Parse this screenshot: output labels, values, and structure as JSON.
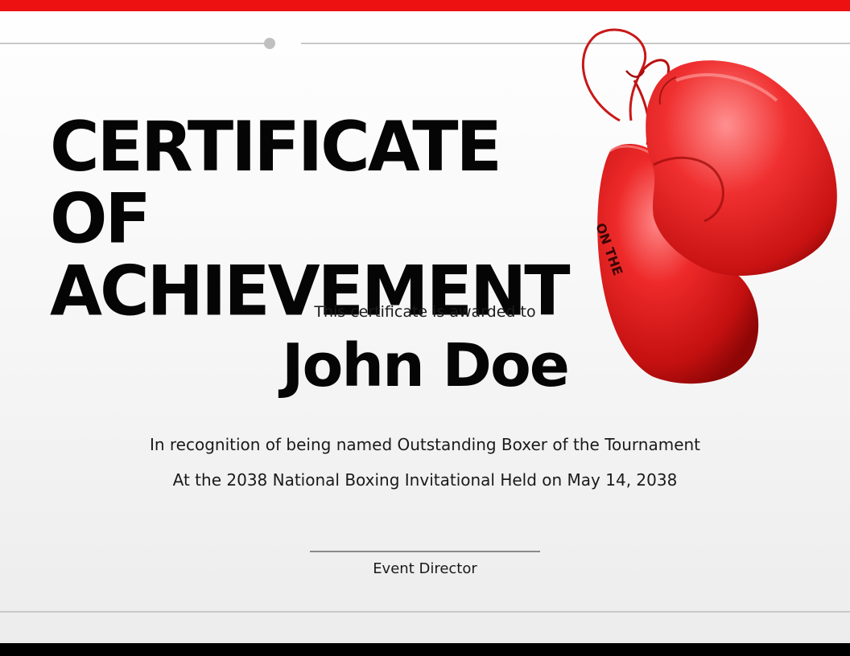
{
  "certificate": {
    "title_line1": "CERTIFICATE OF",
    "title_line2": "ACHIEVEMENT",
    "awarded_text": "This certificate is awarded to",
    "recipient_name": "John Doe",
    "recognition_line1": "In recognition of being named Outstanding Boxer of the Tournament",
    "recognition_line2": "At the 2038 National Boxing Invitational Held on May 14, 2038",
    "signature_label": "Event Director",
    "glove_brand_text": "ON THE"
  },
  "colors": {
    "accent_red": "#ee1111",
    "bottom_bar": "#000000",
    "title_text": "#050505",
    "glove_red": "#d91818"
  },
  "icons": [
    "boxing-gloves-image"
  ]
}
